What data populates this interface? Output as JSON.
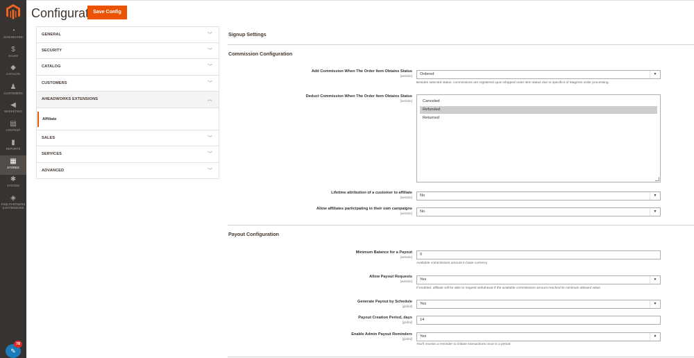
{
  "page": {
    "title": "Configurat...",
    "save_label": "Save Config"
  },
  "admin_nav": [
    {
      "icon": "dashboard-icon",
      "glyph": "◔",
      "label": "DASHBOARD",
      "label2": "",
      "active": false
    },
    {
      "icon": "dollar-icon",
      "glyph": "$",
      "label": "SALES",
      "label2": "",
      "active": false
    },
    {
      "icon": "box-icon",
      "glyph": "◆",
      "label": "CATALOG",
      "label2": "",
      "active": false
    },
    {
      "icon": "person-icon",
      "glyph": "♟",
      "label": "CUSTOMERS",
      "label2": "",
      "active": false
    },
    {
      "icon": "megaphone-icon",
      "glyph": "◀",
      "label": "MARKETING",
      "label2": "",
      "active": false
    },
    {
      "icon": "content-icon",
      "glyph": "▤",
      "label": "CONTENT",
      "label2": "",
      "active": false
    },
    {
      "icon": "reports-icon",
      "glyph": "▮",
      "label": "REPORTS",
      "label2": "",
      "active": false
    },
    {
      "icon": "store-icon",
      "glyph": "▦",
      "label": "STORES",
      "label2": "",
      "active": true
    },
    {
      "icon": "gear-icon",
      "glyph": "✱",
      "label": "SYSTEM",
      "label2": "",
      "active": false
    },
    {
      "icon": "cube-icon",
      "glyph": "◈",
      "label": "FIND PARTNERS",
      "label2": "& EXTENSIONS",
      "active": false
    }
  ],
  "chat": {
    "badge": "78"
  },
  "config_tabs": [
    {
      "label": "GENERAL",
      "open": false
    },
    {
      "label": "SECURITY",
      "open": false
    },
    {
      "label": "CATALOG",
      "open": false
    },
    {
      "label": "CUSTOMERS",
      "open": false
    },
    {
      "label": "AHEADWORKS EXTENSIONS",
      "open": true,
      "sub": "Affiliate"
    },
    {
      "label": "SALES",
      "open": false
    },
    {
      "label": "SERVICES",
      "open": false
    },
    {
      "label": "ADVANCED",
      "open": false
    }
  ],
  "sections": {
    "signup": "Signup Settings",
    "commission": "Commission Configuration",
    "payout": "Payout Configuration"
  },
  "commission": {
    "add_status": {
      "label": "Add Commission When The Order Item Obtains Status",
      "scope": "[website]",
      "value": "Ordered",
      "note": "Besides selected status, commissions are registered upon Shipped order item status due to specifics of Magento order processing."
    },
    "deduct_status": {
      "label": "Deduct Commission When The Order Item Obtains Status",
      "scope": "[website]",
      "options": [
        "Canceled",
        "Refunded",
        "Returned"
      ],
      "selected": "Refunded"
    },
    "lifetime": {
      "label": "Lifetime attribution of a customer to affiliate",
      "scope": "[website]",
      "value": "No"
    },
    "own_campaigns": {
      "label": "Allow affiliates participating in their own campaigns",
      "scope": "[website]",
      "value": "No"
    }
  },
  "payout": {
    "min_balance": {
      "label": "Minimum Balance for a Payout",
      "scope": "[website]",
      "value": "0",
      "note": "Available commissions amount in base currency"
    },
    "allow_requests": {
      "label": "Allow Payout Requests",
      "scope": "[website]",
      "value": "Yes",
      "note": "If enabled, affiliate will be able to request withdrawal if the available commissions amount reached its minimum allowed value"
    },
    "generate_schedule": {
      "label": "Generate Payout by Schedule",
      "scope": "[global]",
      "value": "Yes"
    },
    "creation_period": {
      "label": "Payout Creation Period, days",
      "scope": "[global]",
      "value": "14"
    },
    "admin_reminders": {
      "label": "Enable Admin Payout Reminders",
      "scope": "[global]",
      "value": "Yes",
      "note": "You'll receive a reminder to initiate transactions once in a period"
    }
  }
}
